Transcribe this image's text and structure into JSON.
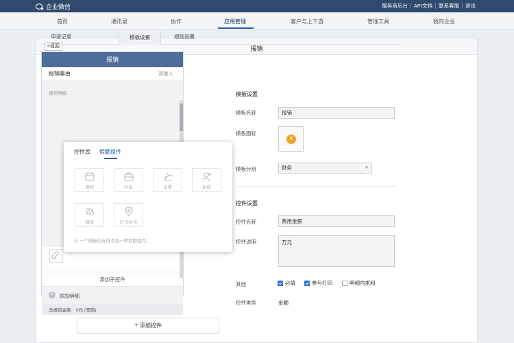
{
  "topbar": {
    "app_name": "企业微信",
    "links": [
      "服务商后台",
      "API文档",
      "联系客服",
      "退出"
    ]
  },
  "nav": {
    "items": [
      "首页",
      "通讯录",
      "协作",
      "应用管理",
      "客户与上下游",
      "管理工具",
      "我的企业"
    ],
    "active_index": 3
  },
  "panel": {
    "back_label": "«返回",
    "title": "报销"
  },
  "tabs": {
    "items": [
      "申请记录",
      "模板设置",
      "规则设置"
    ],
    "active_index": 1
  },
  "phone": {
    "title": "报销",
    "row1_label": "报销事由",
    "row1_placeholder": "请输入",
    "group_label": "报销明细",
    "add_child": "添加子控件",
    "add_detail": "添加明细",
    "total": "总报销金额",
    "total_value": "0元 (零圆)",
    "add_control": "添加控件"
  },
  "popup": {
    "tabs": [
      "控件库",
      "假勤组件"
    ],
    "active_tab": 1,
    "tiles": [
      {
        "label": "请假",
        "icon": "calendar-icon"
      },
      {
        "label": "外出",
        "icon": "briefcase-icon"
      },
      {
        "label": "出差",
        "icon": "plane-icon"
      },
      {
        "label": "加班",
        "icon": "person-plus-icon"
      },
      {
        "label": "调班",
        "icon": "swap-icon"
      },
      {
        "label": "打卡补卡",
        "icon": "location-pin-icon"
      }
    ],
    "hint": "一个模板仅支持添加一种假勤组件。"
  },
  "template": {
    "section_title": "模板设置",
    "name_label": "模板名称",
    "name_value": "报销",
    "icon_label": "模板图标",
    "icon_glyph": "¥",
    "group_label": "模板分组",
    "group_value": "财务"
  },
  "control": {
    "section_title": "控件设置",
    "name_label": "控件名称",
    "name_value": "费用金额",
    "desc_label": "控件说明",
    "desc_value": "万元",
    "other_label": "其他",
    "options": [
      {
        "label": "必填",
        "checked": true
      },
      {
        "label": "参与打印",
        "checked": true
      },
      {
        "label": "明细内求和",
        "checked": false
      }
    ],
    "type_label": "控件类型",
    "type_value": "金额"
  },
  "colors": {
    "topbar": "#2f4a6d",
    "accent": "#2a5fa6",
    "phone_header": "#4c6e9a",
    "coin": "#f0a22e"
  }
}
